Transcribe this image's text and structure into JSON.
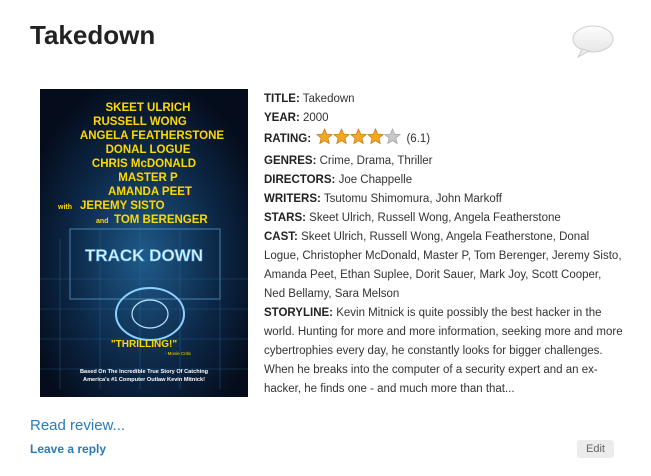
{
  "post": {
    "title": "Takedown",
    "comment_icon": "speech-bubble-icon"
  },
  "poster": {
    "cast_lines": [
      "SKEET ULRICH",
      "RUSSELL WONG",
      "ANGELA FEATHERSTONE",
      "DONAL LOGUE",
      "CHRIS McDONALD",
      "MASTER P",
      "AMANDA PEET"
    ],
    "with_prefix": "with",
    "with_name": "JEREMY SISTO",
    "and_prefix": "and",
    "and_name": "TOM BERENGER",
    "movie_title": "TRACK DOWN",
    "quote": "\"THRILLING!\"",
    "quote_source": "- Movie Critic",
    "tagline_1": "Based On The Incredible True Story Of Catching",
    "tagline_2": "America's #1 Computer Outlaw Kevin Mitnick!"
  },
  "details": {
    "title_label": "TITLE:",
    "title_value": "Takedown",
    "year_label": "YEAR:",
    "year_value": "2000",
    "rating_label": "RATING:",
    "rating_stars": 4,
    "rating_max": 5,
    "rating_value": "(6.1)",
    "genres_label": "GENRES:",
    "genres_value": "Crime, Drama, Thriller",
    "directors_label": "DIRECTORS:",
    "directors_value": "Joe Chappelle",
    "writers_label": "WRITERS:",
    "writers_value": "Tsutomu Shimomura, John Markoff",
    "stars_label": "STARS:",
    "stars_value": "Skeet Ulrich, Russell Wong, Angela Featherstone",
    "cast_label": "CAST:",
    "cast_value": "Skeet Ulrich, Russell Wong, Angela Featherstone, Donal Logue, Christopher McDonald, Master P, Tom Berenger, Jeremy Sisto, Amanda Peet, Ethan Suplee, Dorit Sauer, Mark Joy, Scott Cooper, Ned Bellamy, Sara Melson",
    "storyline_label": "STORYLINE:",
    "storyline_value": "Kevin Mitnick is quite possibly the best hacker in the world. Hunting for more and more information, seeking more and more cybertrophies every day, he constantly looks for bigger challenges. When he breaks into the computer of a security expert and an ex-hacker, he finds one - and much more than that..."
  },
  "links": {
    "read_review": "Read review...",
    "leave_reply": "Leave a reply",
    "edit": "Edit"
  },
  "colors": {
    "link": "#2a7ab8",
    "star_filled": "#f5a623",
    "star_empty": "#c8c8c8",
    "poster_text": "#ffd800"
  }
}
